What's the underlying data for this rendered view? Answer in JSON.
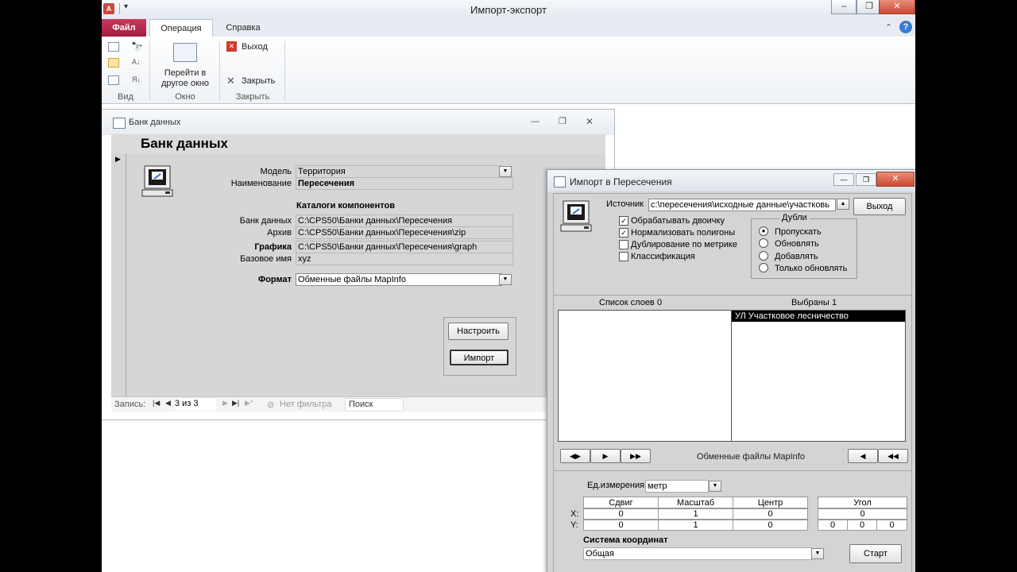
{
  "app": {
    "title": "Импорт-экспорт",
    "qa_icon": "A",
    "tabs": {
      "file": "Файл",
      "operation": "Операция",
      "help": "Справка"
    },
    "ribbon": {
      "view_group": "Вид",
      "window_group": "Окно",
      "close_group": "Закрыть",
      "switch_window_line1": "Перейти в",
      "switch_window_line2": "другое окно",
      "exit": "Выход",
      "close": "Закрыть"
    }
  },
  "bank": {
    "window_title": "Банк данных",
    "header": "Банк данных",
    "labels": {
      "model": "Модель",
      "name": "Наименование",
      "catalogs": "Каталоги компонентов",
      "bank": "Банк данных",
      "archive": "Архив",
      "graphics": "Графика",
      "base_name": "Базовое имя",
      "format": "Формат"
    },
    "values": {
      "model": "Территория",
      "name": "Пересечения",
      "bank": "C:\\CPS50\\Банки данных\\Пересечения",
      "archive": "C:\\CPS50\\Банки данных\\Пересечения\\zip",
      "graphics": "C:\\CPS50\\Банки данных\\Пересечения\\graph",
      "base_name": "xyz",
      "format": "Обменные файлы MapInfo"
    },
    "buttons": {
      "configure": "Настроить",
      "import": "Импорт"
    },
    "nav": {
      "record_label": "Запись:",
      "record_pos": "3 из 3",
      "filter": "Нет фильтра",
      "search": "Поиск"
    }
  },
  "import": {
    "window_title": "Импорт в Пересечения",
    "source_label": "Источник",
    "source_value": "c:\\пересечения\\исходные данные\\участковь",
    "exit_button": "Выход",
    "checkboxes": [
      {
        "label": "Обрабатывать двоичку",
        "checked": true
      },
      {
        "label": "Нормализовать полигоны",
        "checked": true
      },
      {
        "label": "Дублирование по метрике",
        "checked": false
      },
      {
        "label": "Классификация",
        "checked": false
      }
    ],
    "duplicates": {
      "title": "Дубли",
      "options": [
        {
          "label": "Пропускать",
          "selected": true
        },
        {
          "label": "Обновлять",
          "selected": false
        },
        {
          "label": "Добавлять",
          "selected": false
        },
        {
          "label": "Только обновлять",
          "selected": false
        }
      ]
    },
    "layers_label": "Список слоев",
    "layers_count": "0",
    "selected_label": "Выбраны",
    "selected_count": "1",
    "selected_items": [
      "УЛ Участковое лесничество"
    ],
    "format_text": "Обменные файлы MapInfo",
    "units_label": "Ед.измерения",
    "units_value": "метр",
    "grid": {
      "headers": [
        "Сдвиг",
        "Масштаб",
        "Центр",
        "Угол"
      ],
      "row_labels": [
        "X:",
        "Y:"
      ],
      "x": [
        "0",
        "1",
        "0",
        "0"
      ],
      "y": [
        "0",
        "1",
        "0"
      ],
      "angle_y": [
        "0",
        "0",
        "0"
      ]
    },
    "coord_system_label": "Система координат",
    "coord_system_value": "Общая",
    "start_button": "Старт"
  }
}
